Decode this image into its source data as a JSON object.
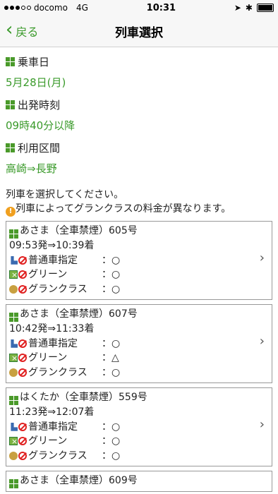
{
  "status": {
    "carrier": "docomo",
    "network": "4G",
    "time": "10:31"
  },
  "nav": {
    "back_label": "戻る",
    "title": "列車選択"
  },
  "sections": [
    {
      "head": "乗車日",
      "value": "5月28日(月)"
    },
    {
      "head": "出発時刻",
      "value": "09時40分以降"
    },
    {
      "head": "利用区間",
      "value": "高崎⇒長野"
    }
  ],
  "instruction": "列車を選択してください。",
  "warning": "列車によってグランクラスの料金が異なります。",
  "trains": [
    {
      "name": "あさま（全車禁煙）605号",
      "time": "09:53発⇒10:39着",
      "seats": [
        {
          "label": "普通車指定",
          "value": "：○"
        },
        {
          "label": "グリーン",
          "value": "：○"
        },
        {
          "label": "グランクラス",
          "value": "：○"
        }
      ]
    },
    {
      "name": "あさま（全車禁煙）607号",
      "time": "10:42発⇒11:33着",
      "seats": [
        {
          "label": "普通車指定",
          "value": "：○"
        },
        {
          "label": "グリーン",
          "value": "：△"
        },
        {
          "label": "グランクラス",
          "value": "：○"
        }
      ]
    },
    {
      "name": "はくたか（全車禁煙）559号",
      "time": "11:23発⇒12:07着",
      "seats": [
        {
          "label": "普通車指定",
          "value": "：○"
        },
        {
          "label": "グリーン",
          "value": "：○"
        },
        {
          "label": "グランクラス",
          "value": "：○"
        }
      ]
    },
    {
      "name": "あさま（全車禁煙）609号"
    }
  ]
}
